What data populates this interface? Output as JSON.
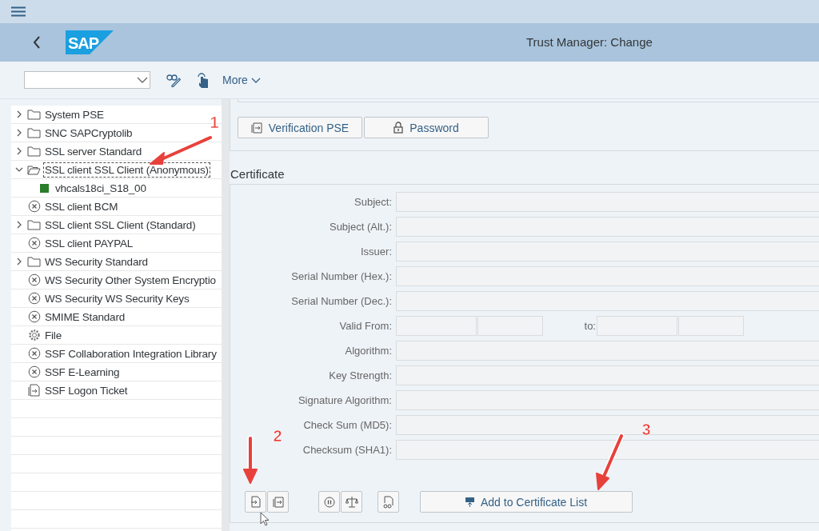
{
  "header": {
    "logo": "SAP",
    "title": "Trust Manager: Change"
  },
  "toolbar": {
    "more": "More"
  },
  "tree": {
    "items": [
      {
        "kind": "folder",
        "label": "System PSE",
        "expanded": false,
        "selected": false
      },
      {
        "kind": "folder",
        "label": "SNC SAPCryptolib",
        "expanded": false,
        "selected": false
      },
      {
        "kind": "folder",
        "label": "SSL server Standard",
        "expanded": false,
        "selected": false
      },
      {
        "kind": "folder",
        "label": "SSL client SSL Client (Anonymous)",
        "expanded": true,
        "selected": true,
        "children": [
          {
            "kind": "certificate",
            "label": "vhcals18ci_S18_00",
            "selected": false
          }
        ]
      },
      {
        "kind": "entry",
        "label": "SSL client BCM",
        "selected": false
      },
      {
        "kind": "folder",
        "label": "SSL client SSL Client (Standard)",
        "expanded": false,
        "selected": false
      },
      {
        "kind": "entry",
        "label": "SSL client PAYPAL",
        "selected": false
      },
      {
        "kind": "folder",
        "label": "WS Security Standard",
        "expanded": false,
        "selected": false
      },
      {
        "kind": "entry",
        "label": "WS Security Other System Encryptio",
        "selected": false
      },
      {
        "kind": "entry",
        "label": "WS Security WS Security Keys",
        "selected": false
      },
      {
        "kind": "entry",
        "label": "SMIME Standard",
        "selected": false
      },
      {
        "kind": "file",
        "label": "File",
        "selected": false
      },
      {
        "kind": "entry",
        "label": "SSF Collaboration Integration Library",
        "selected": false
      },
      {
        "kind": "entry",
        "label": "SSF E-Learning",
        "selected": false
      },
      {
        "kind": "ticket",
        "label": "SSF Logon Ticket",
        "selected": false
      }
    ]
  },
  "pse_buttons": [
    {
      "kind": "verify",
      "label": "Verification PSE"
    },
    {
      "kind": "lock",
      "label": "Password"
    }
  ],
  "certificate": {
    "title": "Certificate",
    "fields": [
      {
        "kind": "wide",
        "label": "Subject:"
      },
      {
        "kind": "wide",
        "label": "Subject (Alt.):"
      },
      {
        "kind": "wide",
        "label": "Issuer:"
      },
      {
        "kind": "wide",
        "label": "Serial Number (Hex.):"
      },
      {
        "kind": "wide",
        "label": "Serial Number (Dec.):"
      },
      {
        "kind": "range",
        "label": "Valid From:",
        "to_label": "to:"
      },
      {
        "kind": "wide",
        "label": "Algorithm:"
      },
      {
        "kind": "wide",
        "label": "Key Strength:"
      },
      {
        "kind": "wide",
        "label": "Signature Algorithm:"
      },
      {
        "kind": "wide",
        "label": "Check Sum (MD5):"
      },
      {
        "kind": "wide",
        "label": "Checksum (SHA1):"
      }
    ],
    "add_button": "Add to Certificate List"
  },
  "annotations": [
    {
      "label": "1"
    },
    {
      "label": "2"
    },
    {
      "label": "3"
    }
  ]
}
